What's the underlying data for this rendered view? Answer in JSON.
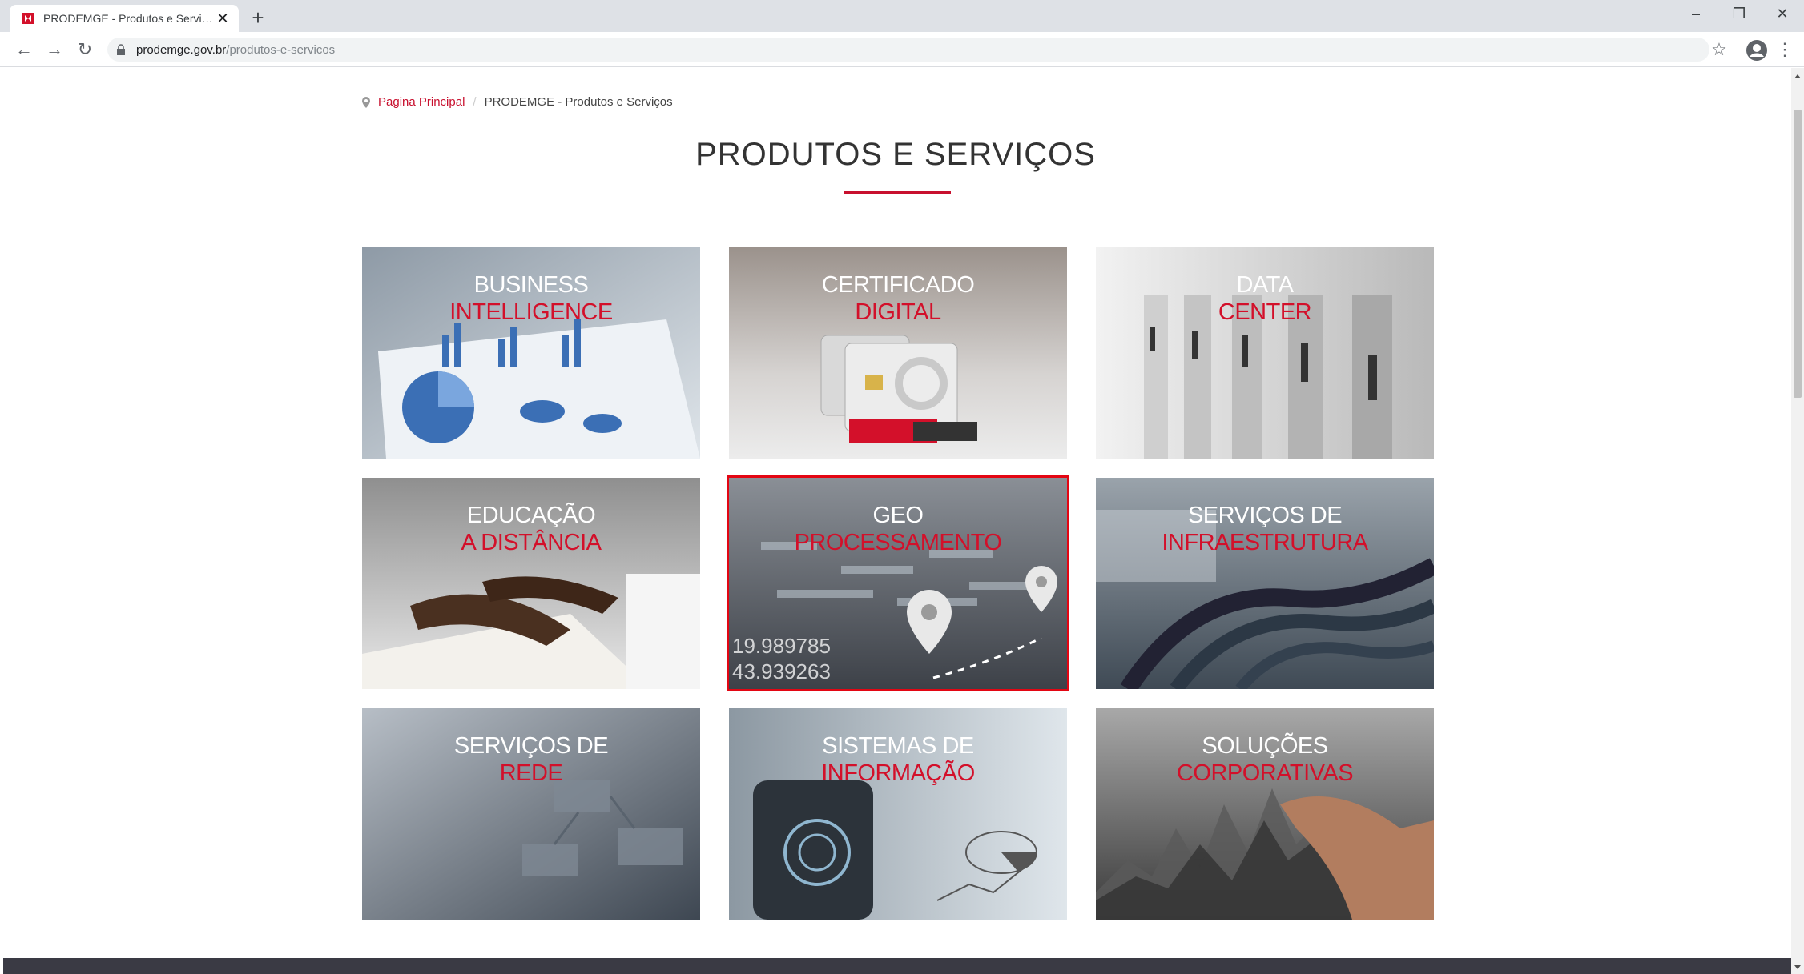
{
  "browser": {
    "tab_title": "PRODEMGE - Produtos e Serviços",
    "url_host": "prodemge.gov.br",
    "url_path": "/produtos-e-servicos"
  },
  "breadcrumb": {
    "home": "Pagina Principal",
    "current": "PRODEMGE - Produtos e Serviços"
  },
  "page_title": "PRODUTOS E SERVIÇOS",
  "cards": [
    {
      "line1": "BUSINESS",
      "line2": "INTELLIGENCE"
    },
    {
      "line1": "CERTIFICADO",
      "line2": "DIGITAL"
    },
    {
      "line1": "DATA",
      "line2": "CENTER"
    },
    {
      "line1": "EDUCAÇÃO",
      "line2": "A DISTÂNCIA"
    },
    {
      "line1": "GEO",
      "line2": "PROCESSAMENTO",
      "coord1": "19.989785",
      "coord2": "43.939263"
    },
    {
      "line1": "SERVIÇOS DE",
      "line2": "INFRAESTRUTURA"
    },
    {
      "line1": "SERVIÇOS DE",
      "line2": "REDE"
    },
    {
      "line1": "SISTEMAS DE",
      "line2": "INFORMAÇÃO"
    },
    {
      "line1": "SOLUÇÕES",
      "line2": "CORPORATIVAS"
    }
  ],
  "colors": {
    "accent": "#c8102e",
    "selection_outline": "#e30613"
  },
  "icons": [
    "favicon-icon",
    "close-icon",
    "plus-icon",
    "back-icon",
    "forward-icon",
    "reload-icon",
    "lock-icon",
    "star-icon",
    "profile-icon",
    "menu-icon",
    "location-pin-icon"
  ]
}
